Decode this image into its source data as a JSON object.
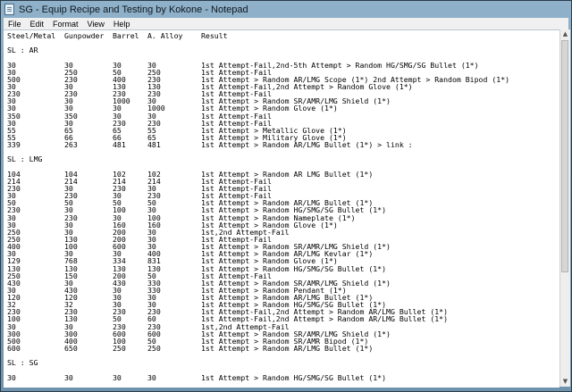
{
  "window": {
    "title": "SG - Equip Recipe and Testing by Kokone - Notepad"
  },
  "menu": [
    "File",
    "Edit",
    "Format",
    "View",
    "Help"
  ],
  "header": {
    "steel": "Steel/Metal",
    "gun": "Gunpowder",
    "barrel": "Barrel",
    "alloy": "A. Alloy",
    "result": "Result"
  },
  "sections": [
    {
      "label": "SL : AR",
      "rows": [
        [
          "30",
          "30",
          "30",
          "30",
          "1st Attempt-Fail,2nd-5th Attempt > Random HG/SMG/SG Bullet (1*)"
        ],
        [
          "30",
          "250",
          "50",
          "250",
          "1st Attempt-Fail"
        ],
        [
          "500",
          "230",
          "400",
          "230",
          "1st Attempt > Random AR/LMG Scope (1*) 2nd Attempt > Random Bipod (1*)"
        ],
        [
          "30",
          "30",
          "130",
          "130",
          "1st Attempt-Fail,2nd Attempt > Random Glove (1*)"
        ],
        [
          "230",
          "230",
          "230",
          "230",
          "1st Attempt-Fail"
        ],
        [
          "30",
          "30",
          "1000",
          "30",
          "1st Attempt > Random SR/AMR/LMG Shield (1*)"
        ],
        [
          "30",
          "30",
          "30",
          "1000",
          "1st Attempt > Random Glove (1*)"
        ],
        [
          "350",
          "350",
          "30",
          "30",
          "1st Attempt-Fail"
        ],
        [
          "30",
          "30",
          "230",
          "230",
          "1st Attempt-Fail"
        ],
        [
          "55",
          "65",
          "65",
          "55",
          "1st Attempt > Metallic Glove (1*)"
        ],
        [
          "55",
          "66",
          "66",
          "65",
          "1st Attempt > Military Glove (1*)"
        ],
        [
          "339",
          "263",
          "481",
          "481",
          "1st Attempt > Random AR/LMG Bullet (1*) > link :"
        ]
      ]
    },
    {
      "label": "SL : LMG",
      "rows": [
        [
          "104",
          "104",
          "102",
          "102",
          "1st Attempt > Random AR LMG Bullet (1*)"
        ],
        [
          "214",
          "214",
          "214",
          "214",
          "1st Attempt-Fail"
        ],
        [
          "230",
          "30",
          "230",
          "30",
          "1st Attempt-Fail"
        ],
        [
          "30",
          "230",
          "30",
          "230",
          "1st Attempt-Fail"
        ],
        [
          "50",
          "50",
          "50",
          "50",
          "1st Attempt > Random AR/LMG Bullet (1*)"
        ],
        [
          "230",
          "30",
          "100",
          "30",
          "1st Attempt > Random HG/SMG/SG Bullet (1*)"
        ],
        [
          "30",
          "230",
          "30",
          "100",
          "1st Attempt > Random Nameplate (1*)"
        ],
        [
          "30",
          "30",
          "160",
          "160",
          "1st Attempt > Random Glove (1*)"
        ],
        [
          "250",
          "30",
          "200",
          "30",
          "1st,2nd Attempt-Fail"
        ],
        [
          "250",
          "130",
          "200",
          "30",
          "1st Attempt-Fail"
        ],
        [
          "400",
          "100",
          "600",
          "30",
          "1st Attempt > Random SR/AMR/LMG Shield (1*)"
        ],
        [
          "30",
          "30",
          "30",
          "400",
          "1st Attempt > Random AR/LMG Kevlar (1*)"
        ],
        [
          "129",
          "768",
          "334",
          "831",
          "1st Attempt > Random Glove (1*)"
        ],
        [
          "130",
          "130",
          "130",
          "130",
          "1st Attempt > Random HG/SMG/SG Bullet (1*)"
        ],
        [
          "250",
          "150",
          "200",
          "50",
          "1st Attempt-Fail"
        ],
        [
          "430",
          "30",
          "430",
          "330",
          "1st Attempt > Random SR/AMR/LMG Shield (1*)"
        ],
        [
          "30",
          "430",
          "30",
          "330",
          "1st Attempt > Random Pendant (1*)"
        ],
        [
          "120",
          "120",
          "30",
          "30",
          "1st Attempt > Random AR/LMG Bullet (1*)"
        ],
        [
          "32",
          "32",
          "30",
          "30",
          "1st Attempt > Random HG/SMG/SG Bullet (1*)"
        ],
        [
          "230",
          "230",
          "230",
          "230",
          "1st Attempt-Fail,2nd Attempt > Random AR/LMG Bullet (1*)"
        ],
        [
          "100",
          "130",
          "50",
          "60",
          "1st Attempt-Fail,2nd Attempt > Random AR/LMG Bullet (1*)"
        ],
        [
          "30",
          "30",
          "230",
          "230",
          "1st,2nd Attempt-Fail"
        ],
        [
          "300",
          "300",
          "600",
          "600",
          "1st Attempt > Random SR/AMR/LMG Shield (1*)"
        ],
        [
          "500",
          "400",
          "100",
          "50",
          "1st Attempt > Random SR/AMR Bipod (1*)"
        ],
        [
          "600",
          "650",
          "250",
          "250",
          "1st Attempt > Random AR/LMG Bullet (1*)"
        ]
      ]
    },
    {
      "label": "SL : SG",
      "rows": [
        [
          "30",
          "30",
          "30",
          "30",
          "1st Attempt > Random HG/SMG/SG Bullet (1*)"
        ]
      ]
    }
  ]
}
